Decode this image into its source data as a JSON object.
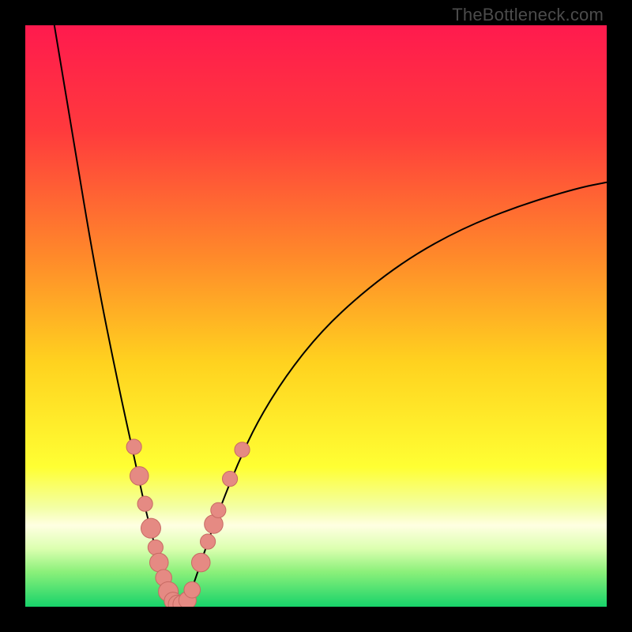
{
  "watermark": "TheBottleneck.com",
  "colors": {
    "frame": "#000000",
    "curve": "#000000",
    "dot_fill": "#e58a83",
    "dot_stroke": "#c76a63"
  },
  "chart_data": {
    "type": "line",
    "title": "",
    "xlabel": "",
    "ylabel": "",
    "xlim": [
      0,
      100
    ],
    "ylim": [
      0,
      100
    ],
    "gradient_stops": [
      {
        "offset": 0.0,
        "color": "#ff1a4e"
      },
      {
        "offset": 0.18,
        "color": "#ff3a3d"
      },
      {
        "offset": 0.4,
        "color": "#ff8a2a"
      },
      {
        "offset": 0.58,
        "color": "#ffd21f"
      },
      {
        "offset": 0.76,
        "color": "#ffff33"
      },
      {
        "offset": 0.83,
        "color": "#f3ffa6"
      },
      {
        "offset": 0.86,
        "color": "#ffffe2"
      },
      {
        "offset": 0.9,
        "color": "#dcffb0"
      },
      {
        "offset": 0.94,
        "color": "#8bf07a"
      },
      {
        "offset": 1.0,
        "color": "#17d36a"
      }
    ],
    "series": [
      {
        "name": "left-curve",
        "x": [
          5.0,
          7.0,
          9.0,
          11.0,
          13.0,
          15.0,
          17.0,
          19.0,
          20.5,
          22.0,
          23.2,
          24.2,
          25.0,
          25.8
        ],
        "y": [
          100.0,
          88.0,
          76.0,
          64.0,
          53.0,
          43.0,
          33.5,
          24.5,
          17.5,
          11.5,
          7.0,
          3.5,
          1.2,
          0.0
        ]
      },
      {
        "name": "right-curve",
        "x": [
          27.5,
          29.0,
          31.0,
          33.5,
          36.5,
          40.0,
          45.0,
          51.0,
          58.0,
          66.0,
          75.0,
          85.0,
          95.0,
          100.0
        ],
        "y": [
          0.0,
          4.0,
          10.0,
          17.0,
          24.5,
          32.0,
          40.0,
          47.5,
          54.0,
          60.0,
          65.0,
          69.0,
          72.0,
          73.0
        ]
      }
    ],
    "minimum_plateau": {
      "x_start": 25.8,
      "x_end": 27.5,
      "y": 0.0
    },
    "dots": [
      {
        "x": 18.7,
        "y": 27.5,
        "r": 1.3
      },
      {
        "x": 19.6,
        "y": 22.5,
        "r": 1.6
      },
      {
        "x": 20.6,
        "y": 17.7,
        "r": 1.3
      },
      {
        "x": 21.6,
        "y": 13.5,
        "r": 1.7
      },
      {
        "x": 22.4,
        "y": 10.2,
        "r": 1.3
      },
      {
        "x": 23.0,
        "y": 7.6,
        "r": 1.6
      },
      {
        "x": 23.8,
        "y": 5.0,
        "r": 1.4
      },
      {
        "x": 24.6,
        "y": 2.6,
        "r": 1.7
      },
      {
        "x": 25.4,
        "y": 1.0,
        "r": 1.5
      },
      {
        "x": 26.2,
        "y": 0.4,
        "r": 1.6
      },
      {
        "x": 27.0,
        "y": 0.4,
        "r": 1.6
      },
      {
        "x": 27.9,
        "y": 1.1,
        "r": 1.5
      },
      {
        "x": 28.7,
        "y": 2.9,
        "r": 1.4
      },
      {
        "x": 30.2,
        "y": 7.6,
        "r": 1.6
      },
      {
        "x": 31.4,
        "y": 11.2,
        "r": 1.3
      },
      {
        "x": 32.4,
        "y": 14.2,
        "r": 1.6
      },
      {
        "x": 33.2,
        "y": 16.6,
        "r": 1.3
      },
      {
        "x": 35.2,
        "y": 22.0,
        "r": 1.3
      },
      {
        "x": 37.3,
        "y": 27.0,
        "r": 1.3
      }
    ]
  }
}
